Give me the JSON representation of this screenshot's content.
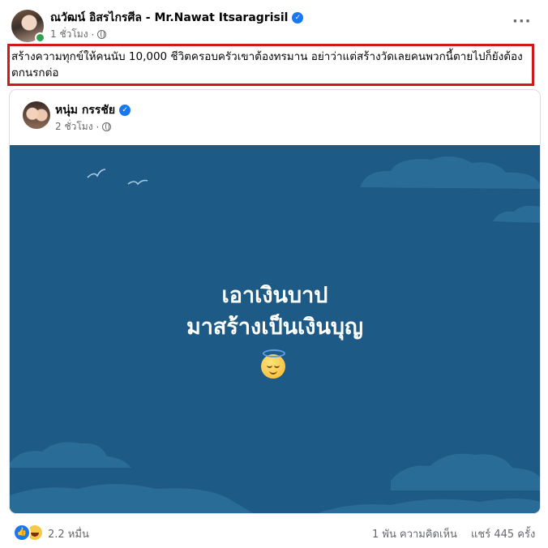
{
  "post": {
    "author": "ณวัฒน์ อิสรไกรศีล - Mr.Nawat Itsaragrisil",
    "time": "1 ชั่วโมง",
    "more_label": "···",
    "text": "สร้างความทุกข์ให้คนนับ 10,000 ชีวิตครอบครัวเขาต้องทรมาน อย่าว่าแต่สร้างวัดเลยคนพวกนี้ตายไปก็ยังต้องตกนรกต่อ"
  },
  "shared_post": {
    "author": "หนุ่ม กรรชัย",
    "time": "2 ชั่วโมง",
    "image_text_line1": "เอาเงินบาป",
    "image_text_line2": "มาสร้างเป็นเงินบุญ",
    "image_emoji": "smiling-face-with-halo",
    "image_bg_color": "#1d5a85"
  },
  "footer": {
    "reactions_count": "2.2 หมื่น",
    "comments": "1 พัน ความคิดเห็น",
    "shares": "แชร์ 445 ครั้ง"
  },
  "colors": {
    "highlight_border": "#d01818",
    "verified": "#1877f2",
    "online": "#31a24c"
  }
}
